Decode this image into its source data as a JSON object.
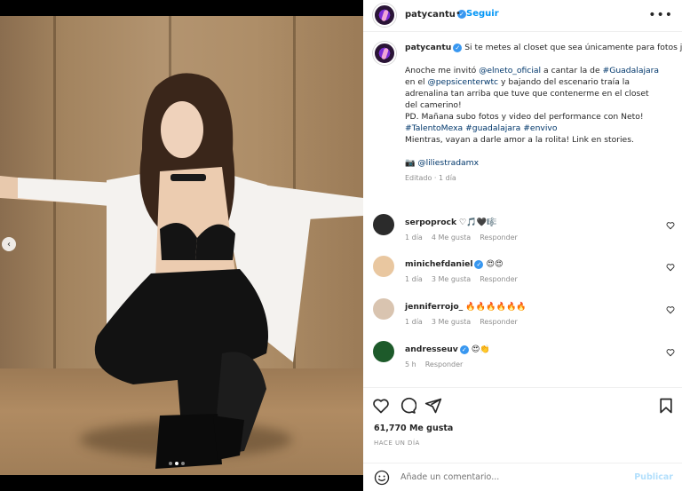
{
  "post": {
    "username": "patycantu",
    "follow_label": "Seguir",
    "more_label": "•••",
    "separator": "•",
    "verified": "✓"
  },
  "caption": {
    "username": "patycantu",
    "lead": "Si te metes al closet que sea únicamente para fotos jajajaja",
    "p2_a": "Anoche me invitó ",
    "p2_mention1": "@elneto_oficial",
    "p2_b": " a cantar la de ",
    "p2_tag1": "#Guadalajara",
    "p2_c": "en el ",
    "p2_mention2": "@pepsicenterwtc",
    "p2_d": " y bajando del escenario traía la",
    "p2_e": "adrenalina tan arriba que tuve que contenerme en el closet",
    "p2_f": "del camerino!",
    "p3": "PD. Mañana subo fotos y video del performance con Neto!",
    "tag2": "#TalentoMexa",
    "tag3": "#guadalajara",
    "tag4": "#envivo",
    "p4": "Mientras, vayan a darle amor a la rolita! Link en stories.",
    "camera_icon": "📷",
    "credit": "@liliestradamx",
    "edited": "Editado · 1 día"
  },
  "comments": [
    {
      "user": "serpoprock",
      "text": "♡🎵🖤🎼",
      "time": "1 día",
      "likes": "4 Me gusta",
      "reply": "Responder",
      "verified": false,
      "avatar_color": "#2b2b2b"
    },
    {
      "user": "minichefdaniel",
      "text": "😍😍",
      "time": "1 día",
      "likes": "3 Me gusta",
      "reply": "Responder",
      "verified": true,
      "avatar_color": "#e9c7a0"
    },
    {
      "user": "jenniferrojo_",
      "text": "🔥🔥🔥🔥🔥🔥",
      "time": "1 día",
      "likes": "3 Me gusta",
      "reply": "Responder",
      "verified": false,
      "avatar_color": "#d9c4b0"
    },
    {
      "user": "andresseuv",
      "text": "😍👏",
      "time": "5 h",
      "likes": "",
      "reply": "Responder",
      "verified": true,
      "avatar_color": "#1d5a2a"
    }
  ],
  "engagement": {
    "likes": "61,770 Me gusta",
    "time_ago": "HACE UN DÍA"
  },
  "composer": {
    "placeholder": "Añade un comentario...",
    "publish": "Publicar"
  },
  "carousel": {
    "prev": "‹",
    "count": 3,
    "active": 2
  }
}
